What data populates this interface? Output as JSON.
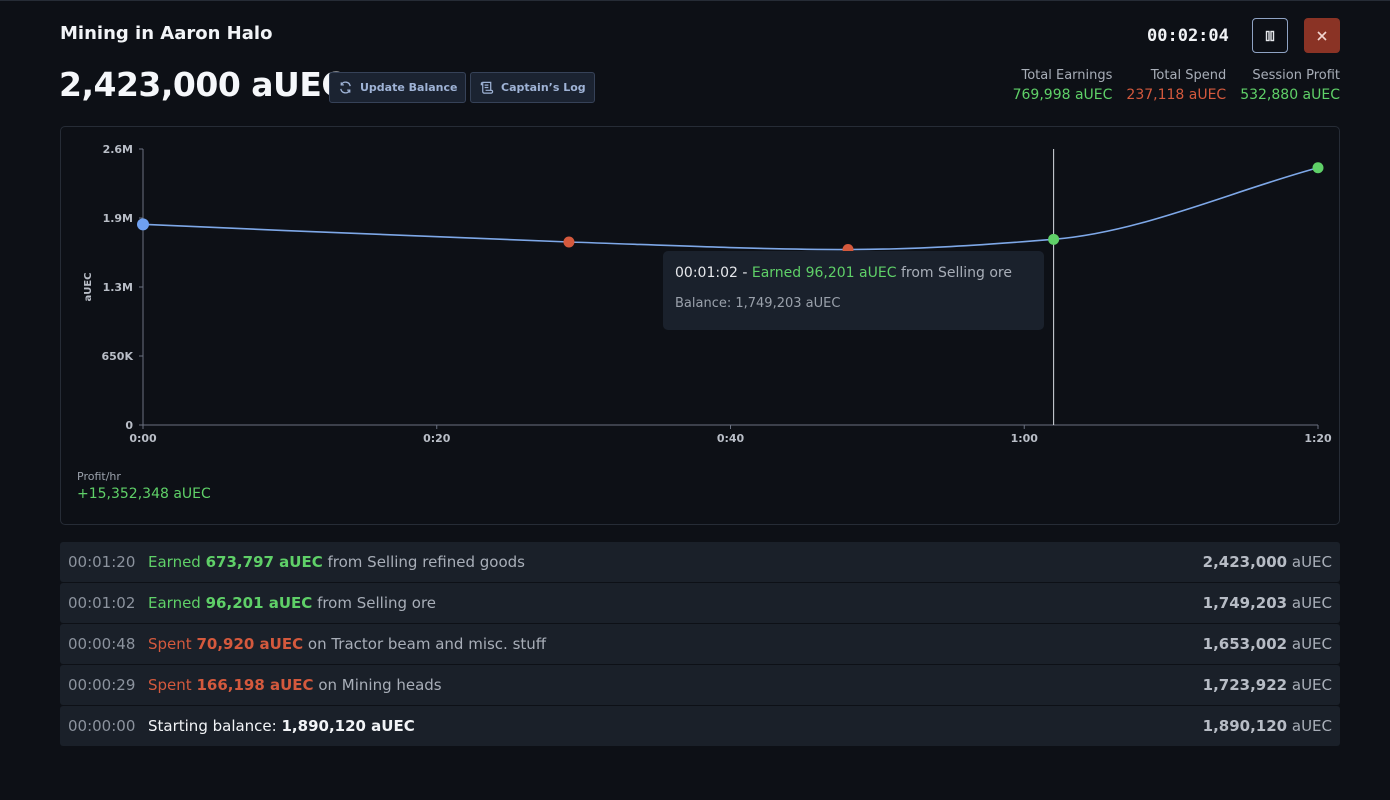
{
  "header": {
    "title": "Mining in Aaron Halo",
    "balance": "2,423,000 aUEC",
    "update_balance_label": "Update Balance",
    "captains_log_label": "Captain’s Log",
    "timer": "00:02:04"
  },
  "stats": {
    "total_earnings_label": "Total Earnings",
    "total_earnings_value": "769,998 aUEC",
    "total_spend_label": "Total Spend",
    "total_spend_value": "237,118 aUEC",
    "session_profit_label": "Session Profit",
    "session_profit_value": "532,880 aUEC"
  },
  "colors": {
    "earn": "#5fd068",
    "spend": "#d4593d",
    "line": "#7ea8e8",
    "start": "#6fa0f0"
  },
  "chart_data": {
    "type": "line",
    "ylabel": "aUEC",
    "xlabel": "",
    "ylim": [
      0,
      2600000
    ],
    "xlim_seconds": [
      0,
      80
    ],
    "y_ticks": [
      "0",
      "650K",
      "1.3M",
      "1.9M",
      "2.6M"
    ],
    "y_tick_values": [
      0,
      650000,
      1300000,
      1950000,
      2600000
    ],
    "x_ticks": [
      "0:00",
      "0:20",
      "0:40",
      "1:00",
      "1:20"
    ],
    "x_tick_values": [
      0,
      20,
      40,
      60,
      80
    ],
    "series": [
      {
        "points": [
          {
            "t": 0,
            "y": 1890120,
            "kind": "start"
          },
          {
            "t": 29,
            "y": 1723922,
            "kind": "spend"
          },
          {
            "t": 48,
            "y": 1653002,
            "kind": "spend"
          },
          {
            "t": 62,
            "y": 1749203,
            "kind": "earn"
          },
          {
            "t": 80,
            "y": 2423000,
            "kind": "earn"
          }
        ]
      }
    ],
    "cursor_t": 62
  },
  "tooltip": {
    "time": "00:01:02",
    "separator": " - ",
    "action": "Earned 96,201 aUEC",
    "rest": " from Selling ore",
    "balance_line": "Balance: 1,749,203 aUEC"
  },
  "profit_hr": {
    "label": "Profit/hr",
    "value": "+15,352,348 aUEC"
  },
  "log": [
    {
      "time": "00:01:20",
      "verb": "Earned",
      "amount": "673,797 aUEC",
      "rest": " from Selling refined goods",
      "balance": "2,423,000",
      "unit": " aUEC",
      "type": "earn"
    },
    {
      "time": "00:01:02",
      "verb": "Earned",
      "amount": "96,201 aUEC",
      "rest": " from Selling ore",
      "balance": "1,749,203",
      "unit": " aUEC",
      "type": "earn"
    },
    {
      "time": "00:00:48",
      "verb": "Spent",
      "amount": "70,920 aUEC",
      "rest": " on Tractor beam and misc. stuff",
      "balance": "1,653,002",
      "unit": " aUEC",
      "type": "spend"
    },
    {
      "time": "00:00:29",
      "verb": "Spent",
      "amount": "166,198 aUEC",
      "rest": " on Mining heads",
      "balance": "1,723,922",
      "unit": " aUEC",
      "type": "spend"
    },
    {
      "time": "00:00:00",
      "verb": "Starting balance:",
      "amount": "1,890,120 aUEC",
      "rest": "",
      "balance": "1,890,120",
      "unit": " aUEC",
      "type": "start"
    }
  ]
}
